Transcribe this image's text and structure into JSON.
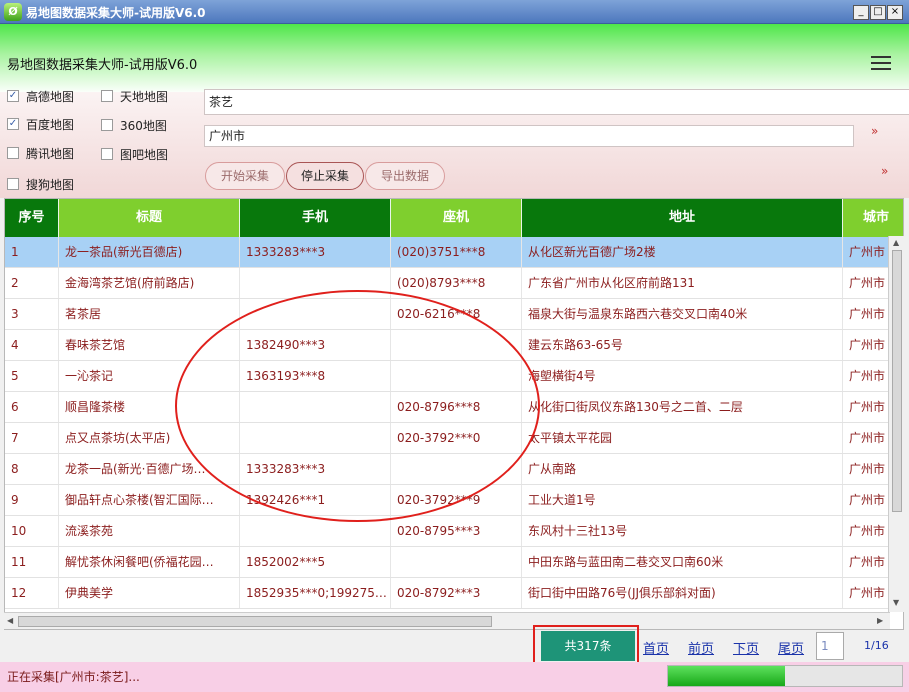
{
  "window": {
    "title": "易地图数据采集大师-试用版V6.0",
    "controls": [
      "_",
      "□",
      "×"
    ]
  },
  "header": {
    "title": "易地图数据采集大师-试用版V6.0",
    "menu_icon": "hamburger-menu-icon"
  },
  "sources": [
    {
      "label": "高德地图",
      "checked": true
    },
    {
      "label": "百度地图",
      "checked": true
    },
    {
      "label": "腾讯地图",
      "checked": false
    },
    {
      "label": "搜狗地图",
      "checked": false
    },
    {
      "label": "天地地图",
      "checked": false
    },
    {
      "label": "360地图",
      "checked": false
    },
    {
      "label": "图吧地图",
      "checked": false
    }
  ],
  "search": {
    "keyword": "茶艺",
    "city": "广州市"
  },
  "actions": {
    "start": "开始采集",
    "stop": "停止采集",
    "export": "导出数据",
    "expand": "»"
  },
  "table": {
    "headers": [
      "序号",
      "标题",
      "手机",
      "座机",
      "地址",
      "城市"
    ],
    "selected_row": 0,
    "rows": [
      [
        "1",
        "龙一茶品(新光百德店)",
        "1333283***3",
        "(020)3751***8",
        "从化区新光百德广场2楼",
        "广州市"
      ],
      [
        "2",
        "金海湾茶艺馆(府前路店)",
        "",
        "(020)8793***8",
        "广东省广州市从化区府前路131",
        "广州市"
      ],
      [
        "3",
        "茗茶居",
        "",
        "020-6216***8",
        "福泉大街与温泉东路西六巷交叉口南40米",
        "广州市"
      ],
      [
        "4",
        "春味茶艺馆",
        "1382490***3",
        "",
        "建云东路63-65号",
        "广州市"
      ],
      [
        "5",
        "一沁茶记",
        "1363193***8",
        "",
        "海塱横街4号",
        "广州市"
      ],
      [
        "6",
        "顺昌隆茶楼",
        "",
        "020-8796***8",
        "从化街口街凤仪东路130号之二首、二层",
        "广州市"
      ],
      [
        "7",
        "点又点茶坊(太平店)",
        "",
        "020-3792***0",
        "太平镇太平花园",
        "广州市"
      ],
      [
        "8",
        "龙茶一品(新光·百德广场…",
        "1333283***3",
        "",
        "广从南路",
        "广州市"
      ],
      [
        "9",
        "御品轩点心茶楼(智汇国际…",
        "1392426***1",
        "020-3792***9",
        "工业大道1号",
        "广州市"
      ],
      [
        "10",
        "流溪茶苑",
        "",
        "020-8795***3",
        "东风村十三社13号",
        "广州市"
      ],
      [
        "11",
        "解忧茶休闲餐吧(侨福花园…",
        "1852002***5",
        "",
        "中田东路与蓝田南二巷交叉口南60米",
        "广州市"
      ],
      [
        "12",
        "伊典美学",
        "1852935***0;199275…",
        "020-8792***3",
        "街口街中田路76号(JJ俱乐部斜对面)",
        "广州市"
      ]
    ]
  },
  "pager": {
    "total": "共317条",
    "first": "首页",
    "prev": "前页",
    "next": "下页",
    "last": "尾页",
    "current": "1",
    "count": "1/16"
  },
  "status": {
    "text": "正在采集[广州市:茶艺]...",
    "progress_percent": 50
  },
  "colors": {
    "header_dark": "#08780c",
    "header_light": "#7fcf2e",
    "highlight": "#e0201c",
    "total_badge": "#1e9478"
  }
}
